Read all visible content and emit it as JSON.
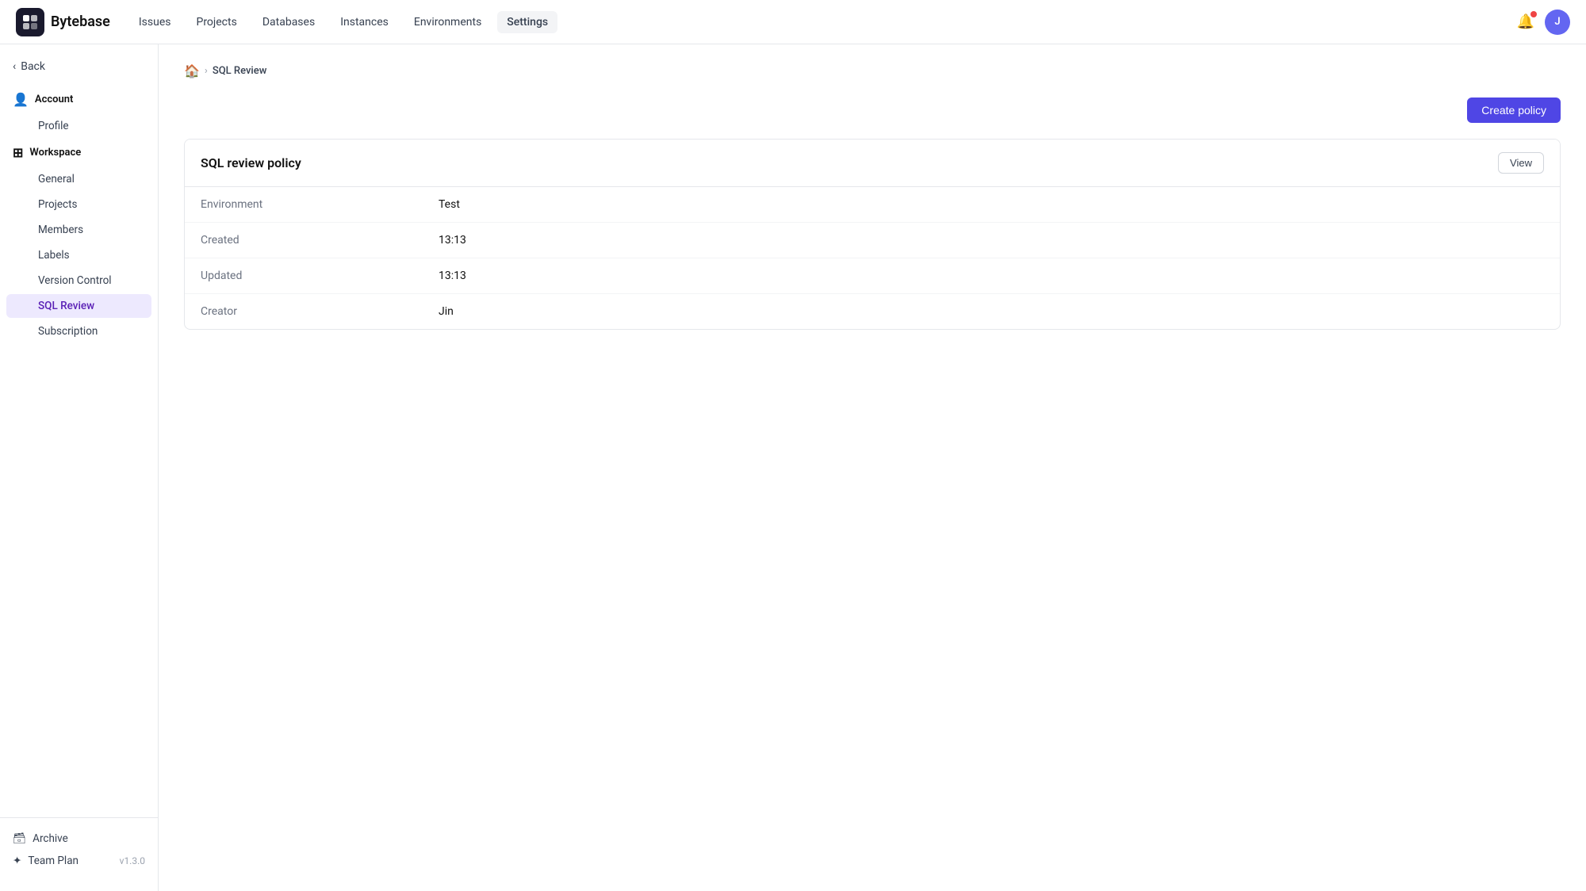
{
  "app": {
    "logo_text": "Bytebase",
    "logo_icon": "B"
  },
  "topnav": {
    "items": [
      {
        "label": "Issues",
        "active": false
      },
      {
        "label": "Projects",
        "active": false
      },
      {
        "label": "Databases",
        "active": false
      },
      {
        "label": "Instances",
        "active": false
      },
      {
        "label": "Environments",
        "active": false
      },
      {
        "label": "Settings",
        "active": true
      }
    ],
    "avatar_label": "J"
  },
  "sidebar": {
    "back_label": "Back",
    "sections": [
      {
        "id": "account",
        "label": "Account",
        "items": [
          {
            "label": "Profile",
            "active": false
          }
        ]
      },
      {
        "id": "workspace",
        "label": "Workspace",
        "items": [
          {
            "label": "General",
            "active": false
          },
          {
            "label": "Projects",
            "active": false
          },
          {
            "label": "Members",
            "active": false
          },
          {
            "label": "Labels",
            "active": false
          },
          {
            "label": "Version Control",
            "active": false
          },
          {
            "label": "SQL Review",
            "active": true
          },
          {
            "label": "Subscription",
            "active": false
          }
        ]
      }
    ],
    "bottom": {
      "archive_label": "Archive",
      "plan_label": "Team Plan",
      "version": "v1.3.0"
    }
  },
  "breadcrumb": {
    "home_icon": "🏠",
    "separator": "›",
    "current": "SQL Review"
  },
  "header": {
    "create_policy_label": "Create policy"
  },
  "policy": {
    "title": "SQL review policy",
    "view_label": "View",
    "rows": [
      {
        "label": "Environment",
        "value": "Test"
      },
      {
        "label": "Created",
        "value": "13:13"
      },
      {
        "label": "Updated",
        "value": "13:13"
      },
      {
        "label": "Creator",
        "value": "Jin"
      }
    ]
  }
}
